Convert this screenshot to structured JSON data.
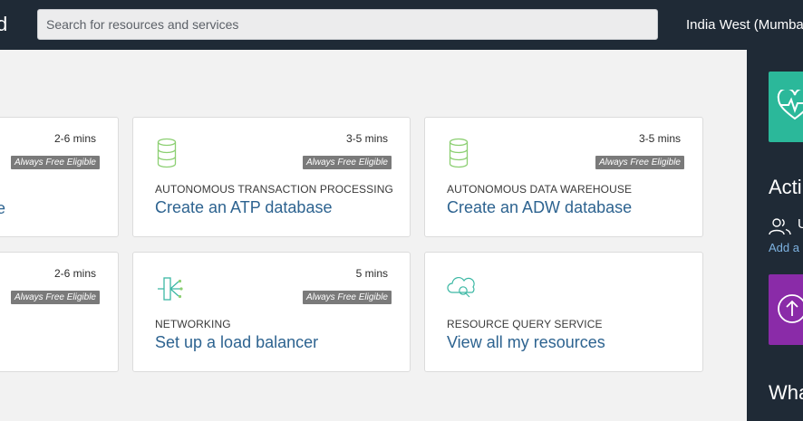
{
  "header": {
    "brand_fragment": "d",
    "search": {
      "placeholder": "Search for resources and services"
    },
    "region": "India West (Mumbai)"
  },
  "cards": [
    {
      "mins": "2-6 mins",
      "badge": "Always Free Eligible",
      "category": "",
      "action": "ce"
    },
    {
      "mins": "3-5 mins",
      "badge": "Always Free Eligible",
      "category": "AUTONOMOUS TRANSACTION PROCESSING",
      "action": "Create an ATP database",
      "icon": "database-icon"
    },
    {
      "mins": "3-5 mins",
      "badge": "Always Free Eligible",
      "category": "AUTONOMOUS DATA WAREHOUSE",
      "action": "Create an ADW database",
      "icon": "database-icon"
    },
    {
      "mins": "2-6 mins",
      "badge": "Always Free Eligible",
      "category": "",
      "action": ""
    },
    {
      "mins": "5 mins",
      "badge": "Always Free Eligible",
      "category": "NETWORKING",
      "action": "Set up a load balancer",
      "icon": "load-balancer-icon"
    },
    {
      "mins": "",
      "badge": "",
      "category": "RESOURCE QUERY SERVICE",
      "action": "View all my resources",
      "icon": "cloud-search-icon"
    }
  ],
  "right_panel": {
    "activity_heading": "Acti",
    "user_text": "U",
    "add_link": "Add a",
    "whats_heading": "Wha",
    "colors": {
      "health_tile": "#2bb89a",
      "upload_tile": "#8a2ba8",
      "panel_bg": "#1f2a36"
    }
  },
  "colors": {
    "topbar_bg": "#1f2a36",
    "link_blue": "#2d6390",
    "badge_gray": "#7a7a7a"
  }
}
